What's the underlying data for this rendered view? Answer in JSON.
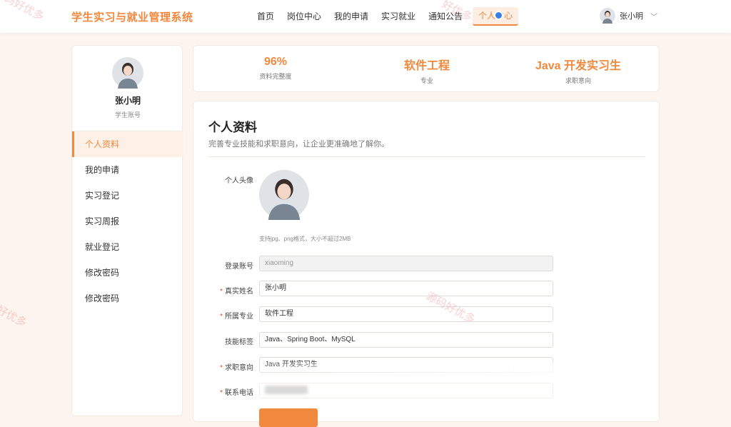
{
  "app": {
    "title": "学生实习与就业管理系统"
  },
  "nav": {
    "items": [
      "首页",
      "岗位中心",
      "我的申请",
      "实习就业",
      "通知公告",
      "个人中心"
    ],
    "active_index": 5
  },
  "user": {
    "name": "张小明"
  },
  "sidebar": {
    "name": "张小明",
    "role": "学生账号",
    "menu": [
      "个人资料",
      "我的申请",
      "实习登记",
      "实习周报",
      "就业登记",
      "修改密码",
      "修改密码"
    ],
    "active_index": 0
  },
  "stats": [
    {
      "value": "96%",
      "label": "资料完整度"
    },
    {
      "value": "软件工程",
      "label": "专业"
    },
    {
      "value": "Java 开发实习生",
      "label": "求职意向"
    }
  ],
  "profile": {
    "title": "个人资料",
    "subtitle": "完善专业技能和求职意向，让企业更准确地了解你。",
    "avatar_label": "个人头像",
    "avatar_hint": "支持jpg、png格式，大小不超过2MB",
    "fields": {
      "account": {
        "label": "登录账号",
        "value": "xiaoming",
        "required": false
      },
      "realname": {
        "label": "真实姓名",
        "value": "张小明",
        "required": true
      },
      "major": {
        "label": "所属专业",
        "value": "软件工程",
        "required": true
      },
      "skills": {
        "label": "技能标签",
        "value": "Java、Spring Boot、MySQL",
        "required": false
      },
      "intent": {
        "label": "求职意向",
        "value": "Java 开发实习生",
        "required": true
      },
      "phone": {
        "label": "联系电话",
        "value": "",
        "required": true
      }
    }
  },
  "watermarks": [
    "源码好优多",
    "好优多",
    "好优多",
    "源码好优多"
  ],
  "colors": {
    "accent": "#f0883d",
    "accent_bg": "#fdf0e6",
    "page_bg": "#fcf4ee",
    "required": "#e04b3a"
  },
  "icons": {
    "avatar": "user-avatar-icon",
    "dropdown": "chevron-down-icon"
  }
}
